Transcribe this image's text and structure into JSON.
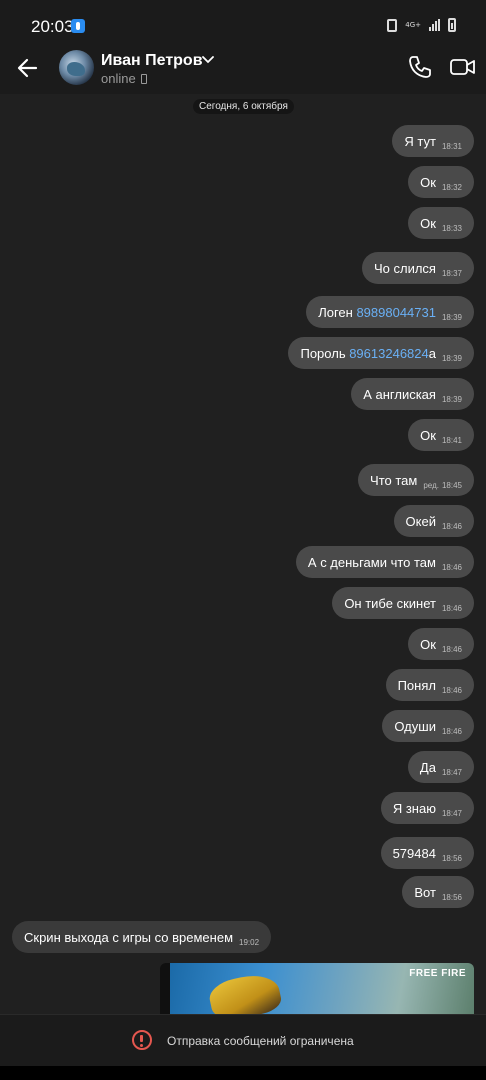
{
  "status_bar": {
    "time": "20:03",
    "network_label": "4G+"
  },
  "header": {
    "contact_name": "Иван Петров",
    "presence": "online",
    "icons": [
      "back-arrow-icon",
      "chevron-down-icon",
      "phone-icon",
      "video-camera-icon"
    ]
  },
  "chat": {
    "date_label": "Сегодня, 6 октября",
    "messages": [
      {
        "text": "Я тут",
        "time": "18:31",
        "direction": "out"
      },
      {
        "text": "Ок",
        "time": "18:32",
        "direction": "out"
      },
      {
        "text": "Ок",
        "time": "18:33",
        "direction": "out"
      },
      {
        "text": "Чо слился",
        "time": "18:37",
        "direction": "out"
      },
      {
        "text": "Логен ",
        "link": "89898044731",
        "time": "18:39",
        "direction": "out"
      },
      {
        "text": "Пороль ",
        "link": "89613246824",
        "suffix": "а",
        "time": "18:39",
        "direction": "out"
      },
      {
        "text": "А англиская",
        "time": "18:39",
        "direction": "out"
      },
      {
        "text": "Ок",
        "time": "18:41",
        "direction": "out"
      },
      {
        "text": "Что там",
        "edited": "ред.",
        "time": "18:45",
        "direction": "out"
      },
      {
        "text": "Окей",
        "time": "18:46",
        "direction": "out"
      },
      {
        "text": "А с деньгами что там",
        "time": "18:46",
        "direction": "out"
      },
      {
        "text": "Он тибе скинет",
        "time": "18:46",
        "direction": "out"
      },
      {
        "text": "Ок",
        "time": "18:46",
        "direction": "out"
      },
      {
        "text": "Понял",
        "time": "18:46",
        "direction": "out"
      },
      {
        "text": "Одуши",
        "time": "18:46",
        "direction": "out"
      },
      {
        "text": "Да",
        "time": "18:47",
        "direction": "out"
      },
      {
        "text": "Я знаю",
        "time": "18:47",
        "direction": "out"
      },
      {
        "text": "579484",
        "time": "18:56",
        "direction": "out"
      },
      {
        "text": "Вот",
        "time": "18:56",
        "direction": "out"
      },
      {
        "text": "Скрин выхода с игры со временем",
        "time": "19:02",
        "direction": "in"
      }
    ],
    "image_message": {
      "brand_text": "FREE FIRE"
    }
  },
  "footer": {
    "restriction_text": "Отправка сообщений ограничена"
  },
  "colors": {
    "outgoing_bubble": "#4a4a4a",
    "incoming_bubble": "#3a3a3a",
    "link": "#6ab0f5",
    "warning": "#e5574f"
  }
}
